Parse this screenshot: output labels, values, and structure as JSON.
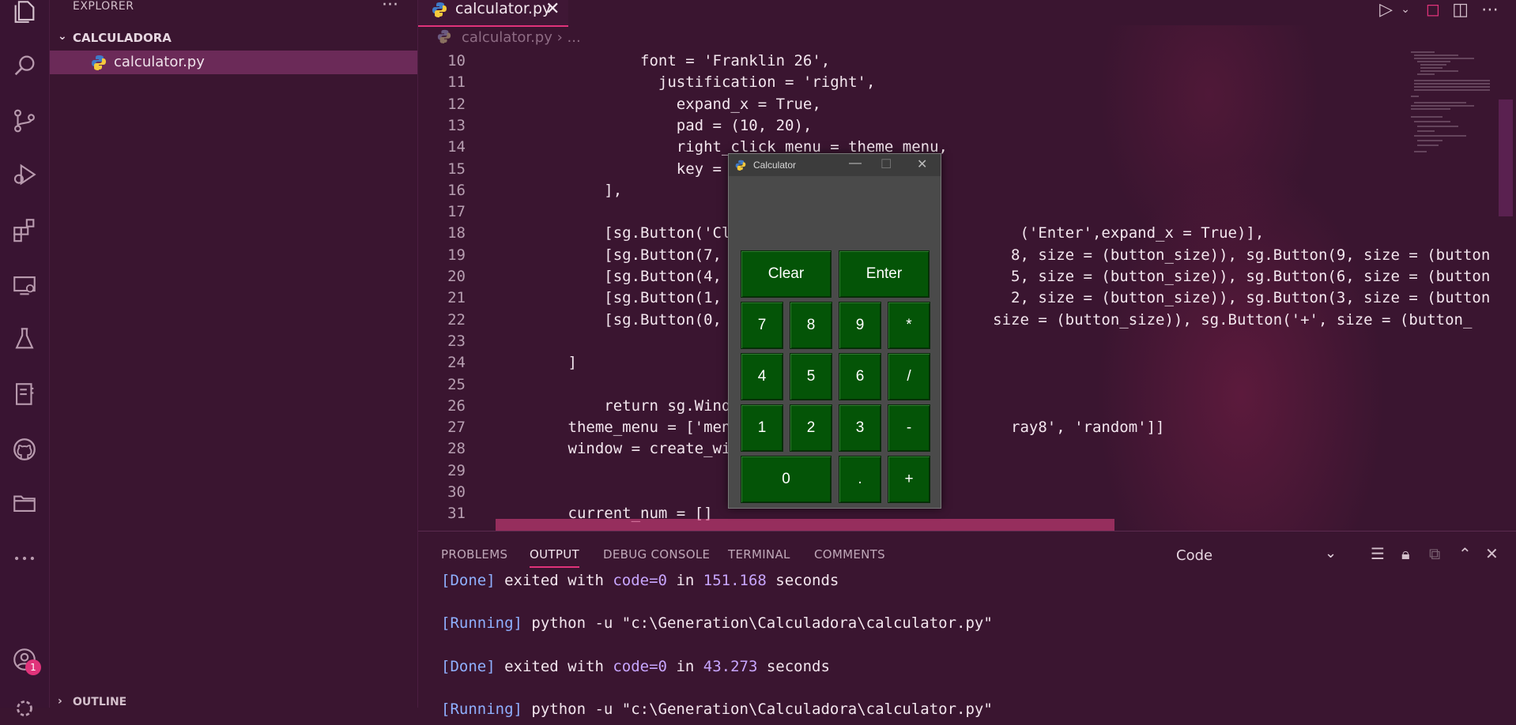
{
  "explorer": {
    "title": "EXPLORER",
    "more": "···",
    "folder": "CALCULADORA",
    "file": "calculator.py",
    "outline": "OUTLINE",
    "account_badge": "1"
  },
  "activity_icons": [
    "files-icon",
    "search-icon",
    "source-control-icon",
    "run-debug-icon",
    "extensions-icon",
    "remote-explorer-icon",
    "testing-icon",
    "notebook-icon",
    "github-icon",
    "folder-icon",
    "more-icon",
    "account-icon",
    "settings-gear-icon"
  ],
  "tab": {
    "label": "calculator.py",
    "close": "✕"
  },
  "breadcrumb": {
    "file": "calculator.py",
    "rest": "› ..."
  },
  "code_lines": [
    {
      "n": "10",
      "t": "                font = 'Franklin 26',"
    },
    {
      "n": "11",
      "t": "                  justification = 'right',"
    },
    {
      "n": "12",
      "t": "                    expand_x = True,"
    },
    {
      "n": "13",
      "t": "                    pad = (10, 20),"
    },
    {
      "n": "14",
      "t": "                    right_click_menu = theme_menu,"
    },
    {
      "n": "15",
      "t": "                    key = '-TE"
    },
    {
      "n": "16",
      "t": "            ],"
    },
    {
      "n": "17",
      "t": ""
    },
    {
      "n": "18",
      "t": "            [sg.Button('Clear', expa                      ('Enter',expand_x = True)],"
    },
    {
      "n": "19",
      "t": "            [sg.Button(7, size = (b                      8, size = (button_size)), sg.Button(9, size = (button"
    },
    {
      "n": "20",
      "t": "            [sg.Button(4, size = (b                      5, size = (button_size)), sg.Button(6, size = (button"
    },
    {
      "n": "21",
      "t": "            [sg.Button(1, size = (b                      2, size = (button_size)), sg.Button(3, size = (button"
    },
    {
      "n": "22",
      "t": "            [sg.Button(0, expand_x                     size = (button_size)), sg.Button('+', size = (button_"
    },
    {
      "n": "23",
      "t": ""
    },
    {
      "n": "24",
      "t": "        ]"
    },
    {
      "n": "25",
      "t": ""
    },
    {
      "n": "26",
      "t": "            return sg.Window('Calcu"
    },
    {
      "n": "27",
      "t": "        theme_menu = ['menu', ['Lig                      ray8', 'random']]"
    },
    {
      "n": "28",
      "t": "        window = create_window('dar"
    },
    {
      "n": "29",
      "t": ""
    },
    {
      "n": "30",
      "t": ""
    },
    {
      "n": "31",
      "t": "        current_num = []"
    }
  ],
  "panel": {
    "tabs": [
      "PROBLEMS",
      "OUTPUT",
      "DEBUG CONSOLE",
      "TERMINAL",
      "COMMENTS"
    ],
    "active_tab": "OUTPUT",
    "output_channel": "Code",
    "lines": [
      {
        "status": "[Done]",
        "text": " exited with ",
        "code": "code=0",
        "in": " in ",
        "secs": "151.168",
        "unit": " seconds"
      },
      {
        "status": "[Running]",
        "text": " python -u \"c:\\Generation\\Calculadora\\calculator.py\""
      },
      {
        "status": "[Done]",
        "text": " exited with ",
        "code": "code=0",
        "in": " in ",
        "secs": "43.273",
        "unit": " seconds"
      },
      {
        "status": "[Running]",
        "text": " python -u \"c:\\Generation\\Calculadora\\calculator.py\""
      }
    ]
  },
  "calculator": {
    "title": "Calculator",
    "buttons": [
      "Clear",
      "Enter",
      "7",
      "8",
      "9",
      "*",
      "4",
      "5",
      "6",
      "/",
      "1",
      "2",
      "3",
      "-",
      "0",
      ".",
      "+"
    ]
  },
  "colors": {
    "background": "#3a1530",
    "accent": "#e0337a",
    "calc_button": "#045407",
    "calc_body": "#4a4a4a"
  }
}
